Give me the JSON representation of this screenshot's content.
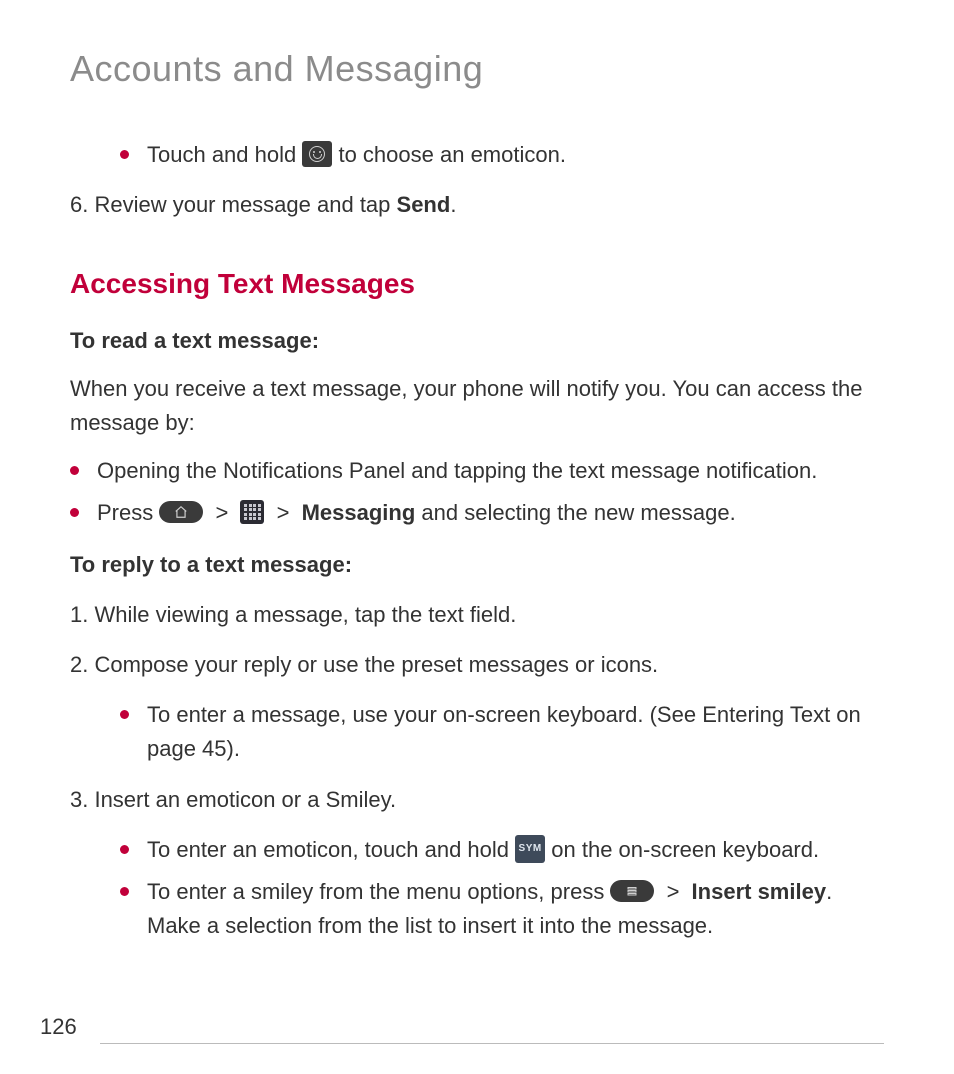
{
  "page_number": "126",
  "chapter_title": "Accounts and Messaging",
  "intro": {
    "bullet_touch_hold_pre": "Touch and hold ",
    "bullet_touch_hold_post": " to choose an emoticon.",
    "step6_pre": "6. Review your message and tap ",
    "step6_bold": "Send",
    "step6_post": "."
  },
  "section_title": "Accessing Text Messages",
  "read": {
    "heading": "To read a text message:",
    "para": "When you receive a text message, your phone will notify you. You can access the message by:",
    "bullet_open": "Opening the Notifications Panel and tapping the text message notification.",
    "bullet_press_pre": "Press ",
    "bullet_press_mid_gt1": ">",
    "bullet_press_mid_gt2": ">",
    "bullet_press_bold": "Messaging",
    "bullet_press_post": " and selecting the new message."
  },
  "reply": {
    "heading": "To reply to a text message:",
    "step1": "1. While viewing a message, tap the text field.",
    "step2": "2. Compose your reply or use the preset messages or icons.",
    "step2_bullet": "To enter a message, use your on-screen keyboard. (See Entering Text on page 45).",
    "step3": "3. Insert an emoticon or a Smiley.",
    "step3_bullet_emoticon_pre": "To enter an emoticon, touch and hold ",
    "step3_bullet_emoticon_post": " on the on-screen keyboard.",
    "step3_bullet_smiley_pre": "To enter a smiley from the menu options, press ",
    "step3_bullet_smiley_gt": ">",
    "step3_bullet_smiley_bold": "Insert smiley",
    "step3_bullet_smiley_post": ". Make a selection from the list to insert it into the message."
  },
  "icons": {
    "sym_label": "SYM"
  }
}
